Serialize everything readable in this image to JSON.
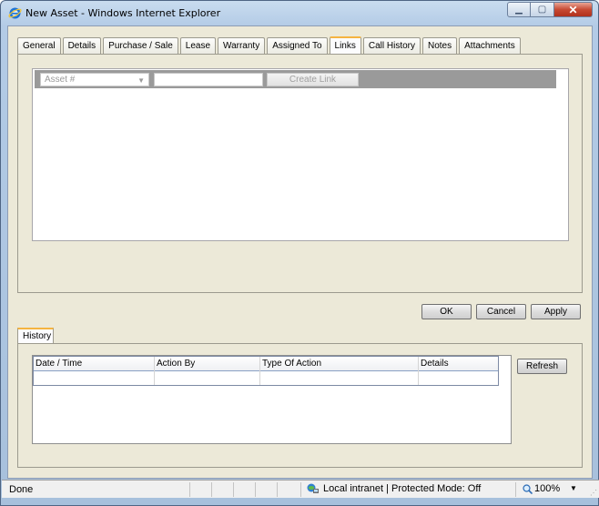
{
  "window": {
    "title": "New Asset - Windows Internet Explorer",
    "icon": "ie-icon",
    "controls": {
      "minimize": "minimize-icon",
      "maximize": "maximize-icon",
      "close": "close-icon"
    }
  },
  "tabs": [
    {
      "label": "General"
    },
    {
      "label": "Details"
    },
    {
      "label": "Purchase / Sale"
    },
    {
      "label": "Lease"
    },
    {
      "label": "Warranty"
    },
    {
      "label": "Assigned To"
    },
    {
      "label": "Links",
      "active": true
    },
    {
      "label": "Call History"
    },
    {
      "label": "Notes"
    },
    {
      "label": "Attachments"
    }
  ],
  "links": {
    "asset_select_value": "Asset #",
    "link_input_value": "",
    "create_link_label": "Create Link"
  },
  "buttons": {
    "ok": "OK",
    "cancel": "Cancel",
    "apply": "Apply",
    "refresh": "Refresh"
  },
  "history": {
    "tab_label": "History",
    "columns": [
      "Date / Time",
      "Action By",
      "Type Of Action",
      "Details"
    ],
    "rows": []
  },
  "statusbar": {
    "status": "Done",
    "zone": "Local intranet | Protected Mode: Off",
    "zoom": "100%"
  },
  "colors": {
    "active_tab_accent": "#f5b441",
    "toolbar_gray": "#9a9a9a",
    "client_bg": "#ece9d8"
  }
}
